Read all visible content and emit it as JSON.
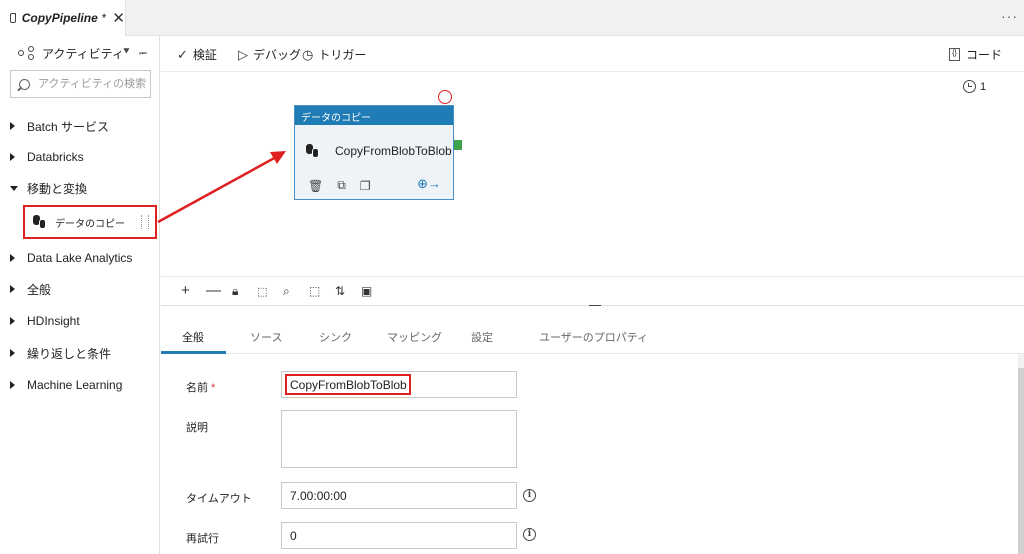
{
  "tab": {
    "title": "CopyPipeline",
    "dirty_marker": "*",
    "close_glyph": "✕",
    "more_glyph": "···"
  },
  "sidebar": {
    "title": "アクティビティ",
    "search_placeholder": "アクティビティの検索",
    "categories": [
      {
        "label": "Batch サービス",
        "expanded": false
      },
      {
        "label": "Databricks",
        "expanded": false
      },
      {
        "label": "移動と変換",
        "expanded": true
      },
      {
        "label": "Data Lake Analytics",
        "expanded": false
      },
      {
        "label": "全般",
        "expanded": false
      },
      {
        "label": "HDInsight",
        "expanded": false
      },
      {
        "label": "繰り返しと条件",
        "expanded": false
      },
      {
        "label": "Machine Learning",
        "expanded": false
      }
    ],
    "copy_item_label": "データのコピー"
  },
  "toolbar": {
    "validate_label": "検証",
    "debug_label": "デバッグ",
    "trigger_label": "トリガー",
    "code_label": "コード"
  },
  "canvas": {
    "param_count": "1",
    "activity": {
      "header": "データのコピー",
      "name": "CopyFromBlobToBlob"
    }
  },
  "properties": {
    "tabs": [
      "全般",
      "ソース",
      "シンク",
      "マッピング",
      "設定",
      "ユーザーのプロパティ"
    ],
    "active_tab": "全般",
    "name_label": "名前",
    "required_marker": "*",
    "name_value": "CopyFromBlobToBlob",
    "description_label": "説明",
    "description_value": "",
    "timeout_label": "タイムアウト",
    "timeout_value": "7.00:00:00",
    "retry_label": "再試行",
    "retry_value": "0"
  },
  "colors": {
    "accent": "#1f7cb5",
    "highlight": "#e02020",
    "port": "#3fa34d"
  }
}
